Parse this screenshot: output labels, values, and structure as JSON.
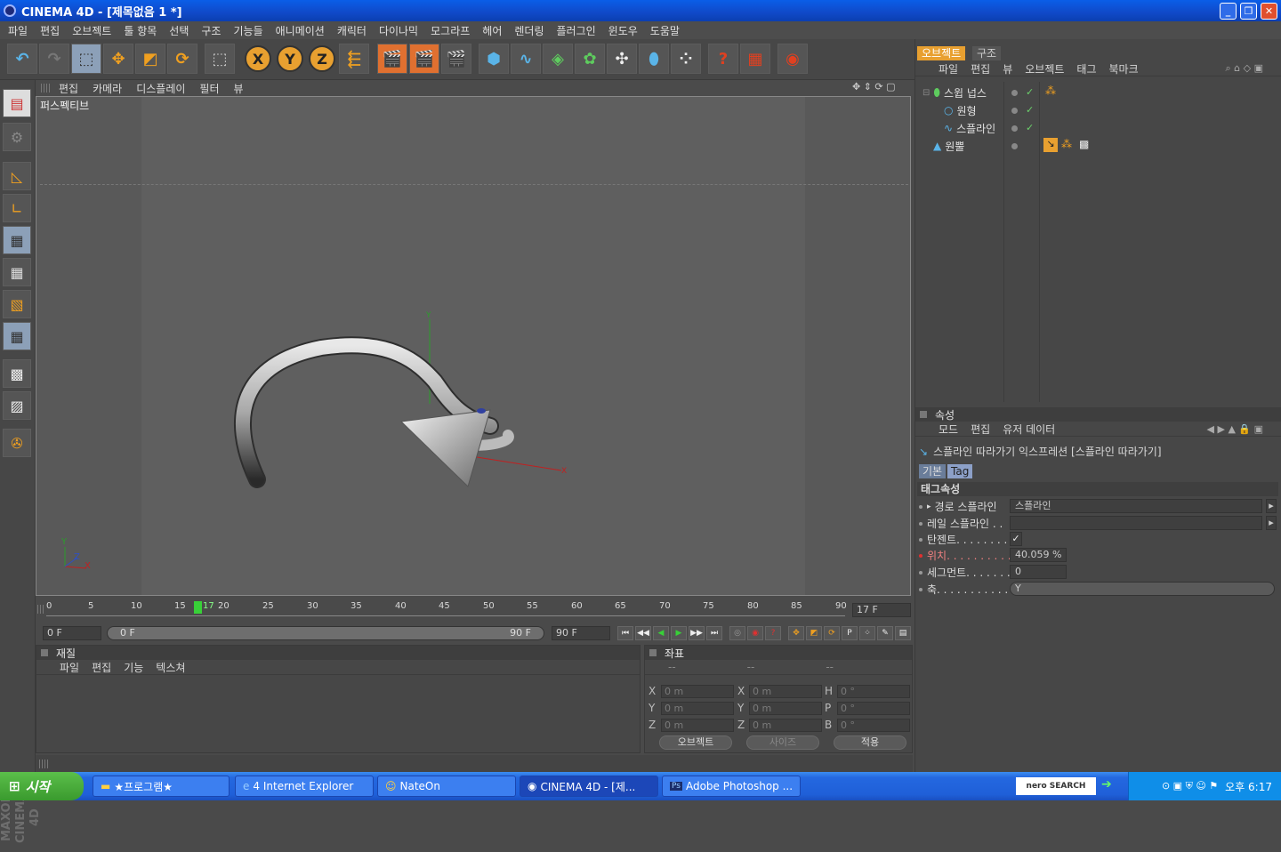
{
  "window": {
    "title": "CINEMA 4D - [제목없음 1 *]",
    "min": "_",
    "max": "❐",
    "close": "✕"
  },
  "menu": [
    "파일",
    "편집",
    "오브젝트",
    "툴 항목",
    "선택",
    "구조",
    "기능들",
    "애니메이션",
    "캐릭터",
    "다이나믹",
    "모그라프",
    "헤어",
    "렌더링",
    "플러그인",
    "윈도우",
    "도움말"
  ],
  "viewport": {
    "menu": [
      "편집",
      "카메라",
      "디스플레이",
      "필터",
      "뷰"
    ],
    "label": "퍼스펙티브",
    "axis_y": "Y",
    "axis_z": "Z",
    "axis_x": "X"
  },
  "timeline": {
    "ticks": [
      "0",
      "5",
      "10",
      "15",
      "20",
      "25",
      "30",
      "35",
      "40",
      "45",
      "50",
      "55",
      "60",
      "65",
      "70",
      "75",
      "80",
      "85",
      "90"
    ],
    "current": "17",
    "frame_field": "17 F"
  },
  "transport": {
    "start": "0 F",
    "range_start": "0 F",
    "range_end": "90 F",
    "end": "90 F"
  },
  "materials": {
    "title": "재질",
    "menu": [
      "파일",
      "편집",
      "기능",
      "텍스쳐"
    ]
  },
  "coords": {
    "title": "좌표",
    "cols": [
      "--",
      "--",
      "--"
    ],
    "rows": [
      {
        "a": "X",
        "av": "0 m",
        "b": "X",
        "bv": "0 m",
        "c": "H",
        "cv": "0 °"
      },
      {
        "a": "Y",
        "av": "0 m",
        "b": "Y",
        "bv": "0 m",
        "c": "P",
        "cv": "0 °"
      },
      {
        "a": "Z",
        "av": "0 m",
        "b": "Z",
        "bv": "0 m",
        "c": "B",
        "cv": "0 °"
      }
    ],
    "mode": "오브젝트",
    "size": "사이즈",
    "apply": "적용"
  },
  "objects": {
    "tabs": [
      "오브젝트",
      "구조"
    ],
    "menu": [
      "파일",
      "편집",
      "뷰",
      "오브젝트",
      "태그",
      "북마크"
    ],
    "tree": [
      "스윕 넙스",
      "원형",
      "스플라인",
      "원뿔"
    ]
  },
  "attributes": {
    "title": "속성",
    "menu": [
      "모드",
      "편집",
      "유저 데이터"
    ],
    "header": "스플라인 따라가기 익스프레션 [스플라인 따라가기]",
    "tabs": [
      "기본",
      "Tag"
    ],
    "section": "태그속성",
    "rows": [
      {
        "label": "경로 스플라인",
        "value": "스플라인"
      },
      {
        "label": "레일 스플라인 . .",
        "value": ""
      },
      {
        "label": "탄젠트. . . . . . . . .",
        "value": "✓"
      },
      {
        "label": "위치. . . . . . . . . . . .",
        "value": "40.059 %"
      },
      {
        "label": "세그먼트. . . . . . . .",
        "value": "0"
      },
      {
        "label": "축. . . . . . . . . . . . . .",
        "value": "Y"
      }
    ]
  },
  "brand": "MAXON CINEMA 4D",
  "taskbar": {
    "start": "시작",
    "tasks": [
      "★프로그램★",
      "4 Internet Explorer",
      "NateOn",
      "CINEMA 4D - [제...",
      "Adobe Photoshop ..."
    ],
    "nero": "nero SEARCH",
    "clock": "오후 6:17"
  },
  "colors": {
    "accent": "#e8a030",
    "xp_blue": "#2468e0"
  }
}
